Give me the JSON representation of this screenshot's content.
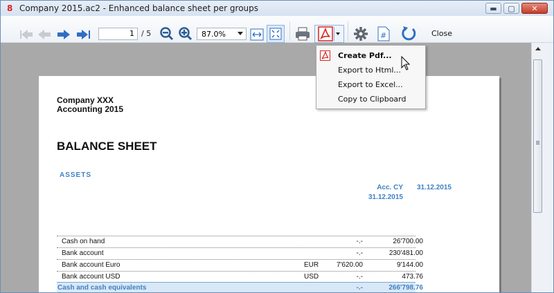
{
  "window": {
    "title": "Company 2015.ac2 - Enhanced balance sheet per groups",
    "app_icon_glyph": "8",
    "controls": [
      "minimize-icon",
      "maximize-icon",
      "close-icon"
    ]
  },
  "toolbar": {
    "page_current": "1",
    "page_total": "/ 5",
    "zoom": "87.0%",
    "close_label": "Close",
    "icons": [
      "first-page-icon",
      "previous-page-icon",
      "next-page-icon",
      "last-page-icon",
      "zoom-out-icon",
      "zoom-in-icon",
      "fit-width-icon",
      "fit-page-icon",
      "print-icon",
      "pdf-icon",
      "settings-icon",
      "page-number-icon",
      "refresh-icon"
    ]
  },
  "menu": {
    "items": [
      {
        "label": "Create Pdf...",
        "icon": "pdf-icon"
      },
      {
        "label": "Export to Html..."
      },
      {
        "label": "Export to Excel..."
      },
      {
        "label": "Copy to Clipboard"
      }
    ]
  },
  "report": {
    "company_line1": "Company XXX",
    "company_line2": "Accounting 2015",
    "title": "BALANCE SHEET",
    "section": "ASSETS",
    "col_acc_line1": "Acc. CY",
    "col_acc_line2": "31.12.2015",
    "col_date": "31.12.2015",
    "rows": [
      {
        "label": "Cash on hand",
        "currency": "",
        "amount_fx": "",
        "acc_cy": "-.-",
        "value": "26'700.00"
      },
      {
        "label": "Bank account",
        "currency": "",
        "amount_fx": "",
        "acc_cy": "-.-",
        "value": "230'481.00"
      },
      {
        "label": "Bank account Euro",
        "currency": "EUR",
        "amount_fx": "7'620.00",
        "acc_cy": "",
        "value": "9'144.00"
      },
      {
        "label": "Bank account USD",
        "currency": "USD",
        "amount_fx": "",
        "acc_cy": "-.-",
        "value": "473.76"
      },
      {
        "label": "Cash and cash equivalents",
        "currency": "",
        "amount_fx": "",
        "acc_cy": "-.-",
        "value": "266'798.76"
      }
    ]
  },
  "colors": {
    "accent_blue": "#3d82c4",
    "pdf_red": "#d9251d",
    "viewport_gray": "#a9a9a9"
  }
}
